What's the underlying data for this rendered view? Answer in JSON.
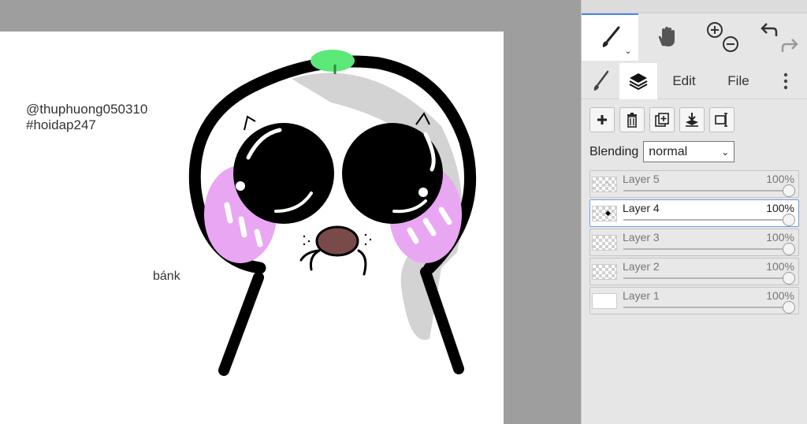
{
  "canvas": {
    "watermark_line1": "@thuphuong050310",
    "watermark_line2": "#hoidap247",
    "note": "bánk"
  },
  "toolbar": {
    "tools": [
      {
        "icon": "brush-icon",
        "active": true
      },
      {
        "icon": "hand-icon",
        "active": false
      },
      {
        "icon": "zoom-in-out-icon",
        "active": false
      },
      {
        "icon": "undo-redo-icon",
        "active": false
      }
    ]
  },
  "tabs": {
    "edit": "Edit",
    "file": "File"
  },
  "layer_actions": [
    "add-layer-icon",
    "delete-layer-icon",
    "duplicate-layer-icon",
    "merge-down-icon",
    "transform-icon"
  ],
  "blending": {
    "label": "Blending",
    "value": "normal"
  },
  "layers": [
    {
      "name": "Layer 5",
      "opacity": "100%",
      "selected": false
    },
    {
      "name": "Layer 4",
      "opacity": "100%",
      "selected": true
    },
    {
      "name": "Layer 3",
      "opacity": "100%",
      "selected": false
    },
    {
      "name": "Layer 2",
      "opacity": "100%",
      "selected": false
    },
    {
      "name": "Layer 1",
      "opacity": "100%",
      "selected": false
    }
  ],
  "colors": {
    "accent": "#4a86e8",
    "blush": "#e9a6f2",
    "leaf": "#5de87a",
    "shade": "#d3d3d3"
  }
}
